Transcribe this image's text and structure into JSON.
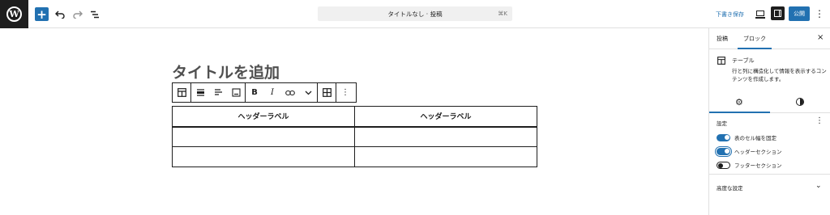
{
  "header": {
    "logo_letter": "W",
    "add_icon": "plus-icon",
    "undo_icon": "undo-icon",
    "redo_icon": "redo-icon",
    "list_view_icon": "list-view-icon",
    "command_bar": {
      "title": "タイトルなし · 投稿",
      "shortcut": "⌘K"
    },
    "save_draft_label": "下書き保存",
    "publish_label": "公開",
    "accent_color": "#2271b1"
  },
  "editor": {
    "title_placeholder": "タイトルを追加",
    "block_toolbar": {
      "groups": [
        [
          "table-icon"
        ],
        [
          "align-icon",
          "justify-icon",
          "caption-icon"
        ],
        [
          "bold-icon",
          "italic-icon",
          "link-icon",
          "more-rich-text-icon"
        ],
        [
          "edit-table-icon"
        ],
        [
          "options-icon"
        ]
      ],
      "bold_glyph": "B",
      "italic_glyph": "I"
    },
    "table": {
      "headers": [
        "ヘッダーラベル",
        "ヘッダーラベル"
      ],
      "rows": [
        [
          "",
          ""
        ],
        [
          "",
          ""
        ]
      ]
    }
  },
  "sidebar": {
    "tabs": [
      "投稿",
      "ブロック"
    ],
    "active_tab": "ブロック",
    "block_card": {
      "title": "テーブル",
      "description": "行と列に構造化して情報を表示するコンテンツを作成します。"
    },
    "settings_heading": "設定",
    "toggles": [
      {
        "label": "表のセル幅を固定",
        "on": true
      },
      {
        "label": "ヘッダーセクション",
        "on": true
      },
      {
        "label": "フッターセクション",
        "on": false
      }
    ],
    "advanced_label": "高度な設定"
  }
}
